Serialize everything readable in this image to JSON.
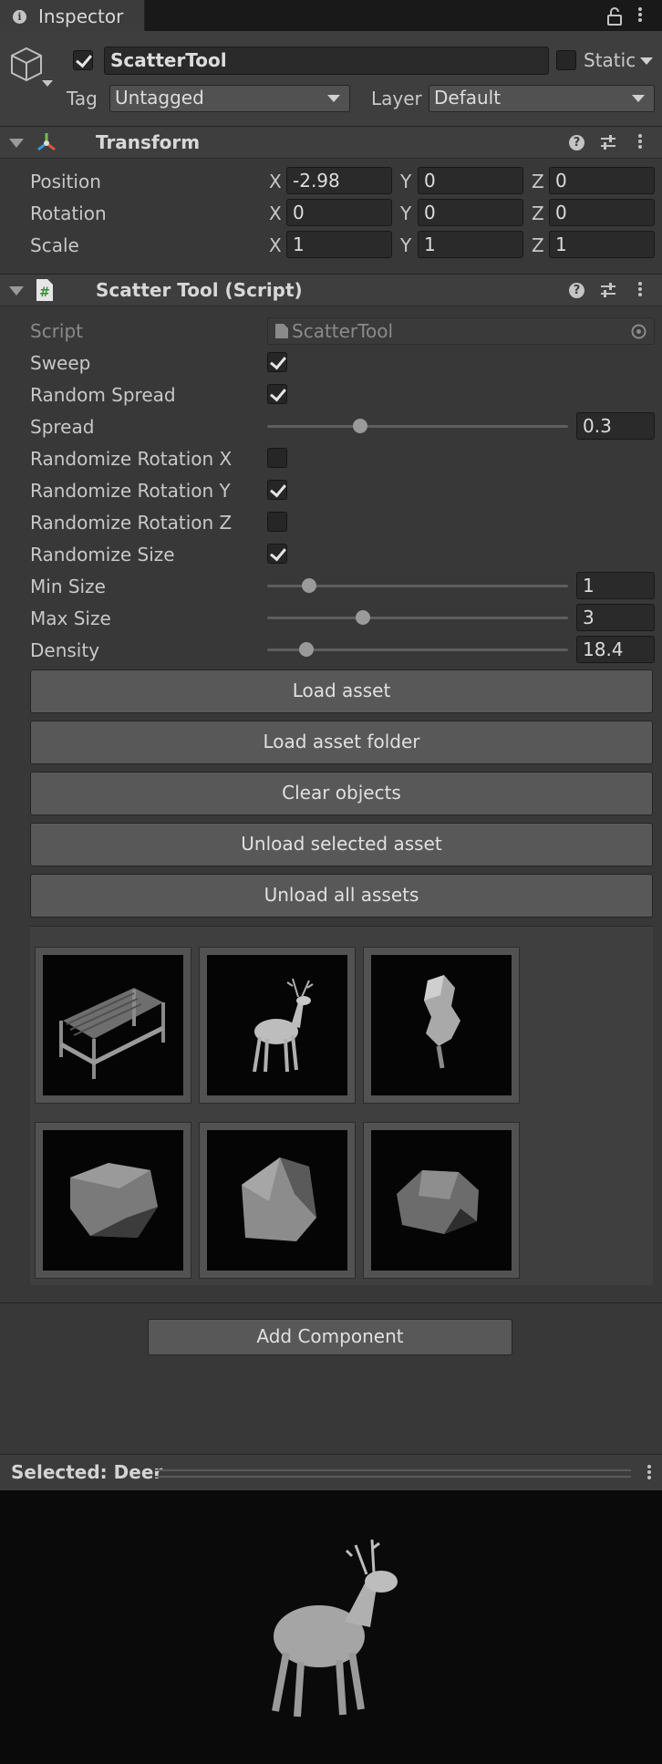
{
  "window": {
    "tab_title": "Inspector"
  },
  "gameobject": {
    "name": "ScatterTool",
    "active": true,
    "static_label": "Static",
    "static_checked": false,
    "tag_label": "Tag",
    "tag_value": "Untagged",
    "layer_label": "Layer",
    "layer_value": "Default"
  },
  "transform": {
    "title": "Transform",
    "rows": [
      {
        "label": "Position",
        "x": "-2.98",
        "y": "0",
        "z": "0"
      },
      {
        "label": "Rotation",
        "x": "0",
        "y": "0",
        "z": "0"
      },
      {
        "label": "Scale",
        "x": "1",
        "y": "1",
        "z": "1"
      }
    ],
    "axis_x": "X",
    "axis_y": "Y",
    "axis_z": "Z"
  },
  "script_component": {
    "title": "Scatter Tool (Script)",
    "script_label": "Script",
    "script_value": "ScatterTool",
    "sweep_label": "Sweep",
    "sweep": true,
    "random_spread_label": "Random Spread",
    "random_spread": true,
    "spread_label": "Spread",
    "spread_value": "0.3",
    "spread_fraction": 0.3,
    "rot_x_label": "Randomize Rotation X",
    "rot_x": false,
    "rot_y_label": "Randomize Rotation Y",
    "rot_y": true,
    "rot_z_label": "Randomize Rotation Z",
    "rot_z": false,
    "rand_size_label": "Randomize Size",
    "rand_size": true,
    "min_size_label": "Min Size",
    "min_size_value": "1",
    "min_size_fraction": 0.12,
    "max_size_label": "Max Size",
    "max_size_value": "3",
    "max_size_fraction": 0.31,
    "density_label": "Density",
    "density_value": "18.4",
    "density_fraction": 0.11,
    "buttons": {
      "load_asset": "Load asset",
      "load_asset_folder": "Load asset folder",
      "clear_objects": "Clear objects",
      "unload_selected": "Unload selected asset",
      "unload_all": "Unload all assets"
    },
    "assets": [
      "bench",
      "deer",
      "tree",
      "rock",
      "rock",
      "rock"
    ]
  },
  "add_component_label": "Add Component",
  "preview": {
    "title": "Selected: Deer"
  }
}
